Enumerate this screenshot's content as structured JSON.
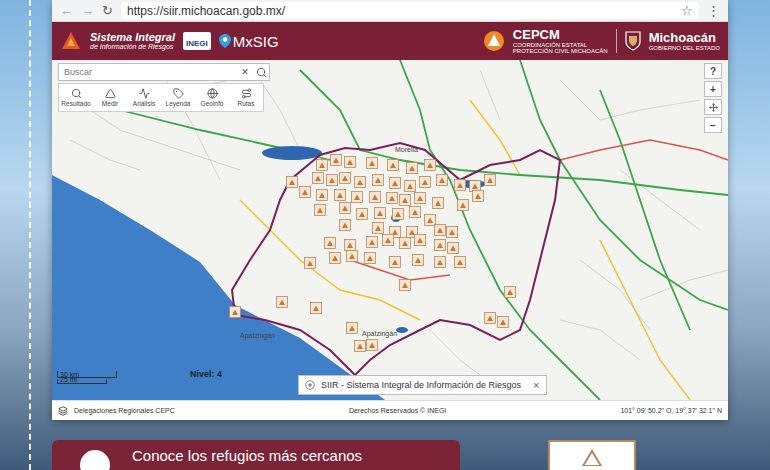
{
  "browser": {
    "back": "←",
    "forward": "→",
    "reload": "↻",
    "url": "https://siir.michoacan.gob.mx/",
    "star": "☆",
    "menu": "⋮"
  },
  "header": {
    "title_line1": "Sistema Integral",
    "title_line2": "de Información de Riesgos",
    "inegi": "INEGI",
    "mxsig": "MxSIG",
    "cepcm": "CEPCM",
    "cepcm_sub1": "COORDINACIÓN ESTATAL",
    "cepcm_sub2": "PROTECCIÓN CIVIL MICHOACÁN",
    "state": "Michoacán",
    "state_sub": "GOBIERNO DEL ESTADO"
  },
  "search": {
    "placeholder": "Buscar",
    "clear": "×"
  },
  "tools": [
    {
      "label": "Resultado"
    },
    {
      "label": "Medir"
    },
    {
      "label": "Análisis"
    },
    {
      "label": "Leyenda"
    },
    {
      "label": "Geoinfo"
    },
    {
      "label": "Rutas"
    }
  ],
  "zoom": {
    "help": "?",
    "in": "+",
    "out": "−"
  },
  "map": {
    "labels": [
      "Morelia",
      "Apatzingán",
      "Apatzingán"
    ],
    "scale": [
      "30 km",
      "25 mi"
    ],
    "level": "Nivel: 4"
  },
  "popup": {
    "title": "SIIR - Sistema Integral de Información de Riesgos",
    "close": "×"
  },
  "footer": {
    "left": "Delegaciones Regionales CEPC",
    "center": "Derechos Reservados © INEGI",
    "coords": "101° 09' 50.2\" O, 19° 37' 32.1\" N"
  },
  "banner": {
    "text": "Conoce los refugios más cercanos"
  }
}
